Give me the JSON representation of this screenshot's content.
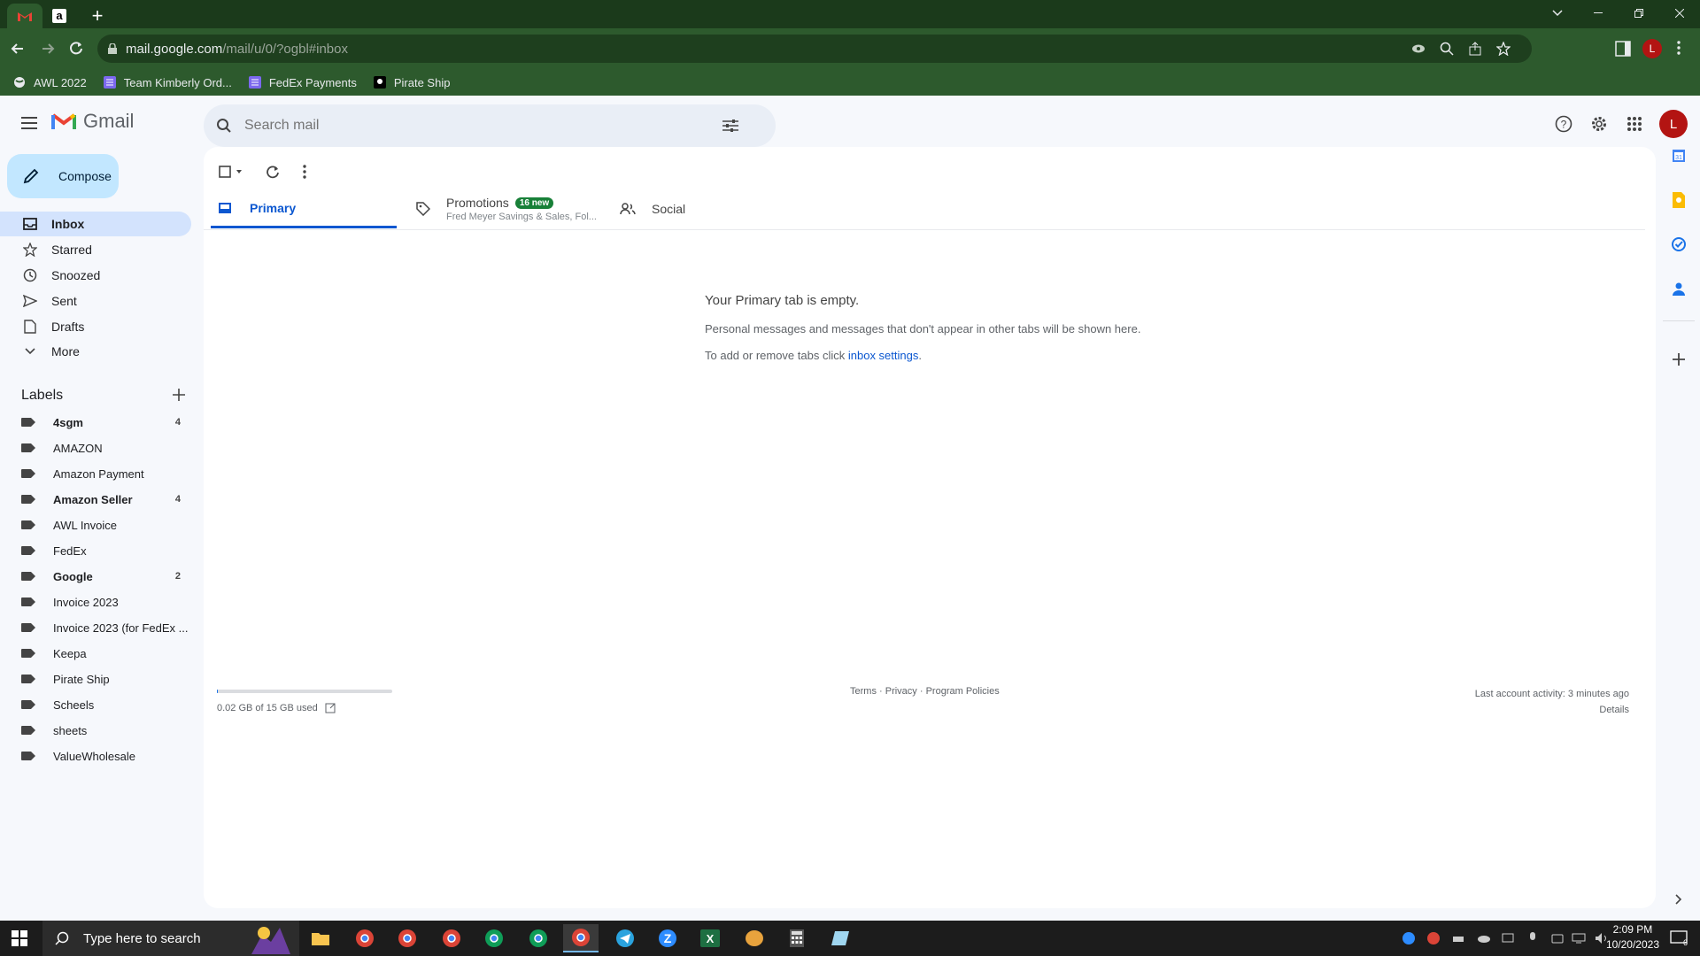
{
  "browser": {
    "url_host": "mail.google.com",
    "url_path": "/mail/u/0/?ogbl#inbox",
    "bookmarks": [
      "AWL 2022",
      "Team Kimberly Ord...",
      "FedEx Payments",
      "Pirate Ship"
    ]
  },
  "gmail": {
    "logo": "Gmail",
    "search_placeholder": "Search mail",
    "avatar_letter": "L",
    "compose": "Compose",
    "nav": [
      {
        "label": "Inbox",
        "icon": "inbox-icon"
      },
      {
        "label": "Starred",
        "icon": "star-icon"
      },
      {
        "label": "Snoozed",
        "icon": "clock-icon"
      },
      {
        "label": "Sent",
        "icon": "send-icon"
      },
      {
        "label": "Drafts",
        "icon": "draft-icon"
      },
      {
        "label": "More",
        "icon": "chevron-down-icon"
      }
    ],
    "labels_heading": "Labels",
    "labels": [
      {
        "name": "4sgm",
        "count": "4"
      },
      {
        "name": "AMAZON",
        "count": ""
      },
      {
        "name": "Amazon Payment",
        "count": ""
      },
      {
        "name": "Amazon Seller",
        "count": "4"
      },
      {
        "name": "AWL Invoice",
        "count": ""
      },
      {
        "name": "FedEx",
        "count": ""
      },
      {
        "name": "Google",
        "count": "2"
      },
      {
        "name": "Invoice 2023",
        "count": ""
      },
      {
        "name": "Invoice 2023 (for FedEx ...",
        "count": ""
      },
      {
        "name": "Keepa",
        "count": ""
      },
      {
        "name": "Pirate Ship",
        "count": ""
      },
      {
        "name": "Scheels",
        "count": ""
      },
      {
        "name": "sheets",
        "count": ""
      },
      {
        "name": "ValueWholesale",
        "count": ""
      }
    ],
    "tabs": {
      "primary": "Primary",
      "promotions": "Promotions",
      "promotions_badge": "16 new",
      "promotions_sub": "Fred Meyer Savings & Sales, Fol...",
      "social": "Social"
    },
    "empty": {
      "title": "Your Primary tab is empty.",
      "line1": "Personal messages and messages that don't appear in other tabs will be shown here.",
      "line2_prefix": "To add or remove tabs click ",
      "line2_link": "inbox settings",
      "line2_suffix": "."
    },
    "storage": {
      "text": "0.02 GB of 15 GB used",
      "fraction": 0.0013
    },
    "footer": {
      "terms": "Terms",
      "privacy": "Privacy",
      "policies": "Program Policies"
    },
    "activity": {
      "line1": "Last account activity: 3 minutes ago",
      "details": "Details"
    }
  },
  "taskbar": {
    "search_placeholder": "Type here to search",
    "time": "2:09 PM",
    "date": "10/20/2023",
    "notification_count": "6"
  },
  "colors": {
    "accent": "#0b57d0",
    "compose_bg": "#c2e7ff",
    "browser_green": "#2d5a2d",
    "avatar": "#b31412"
  }
}
